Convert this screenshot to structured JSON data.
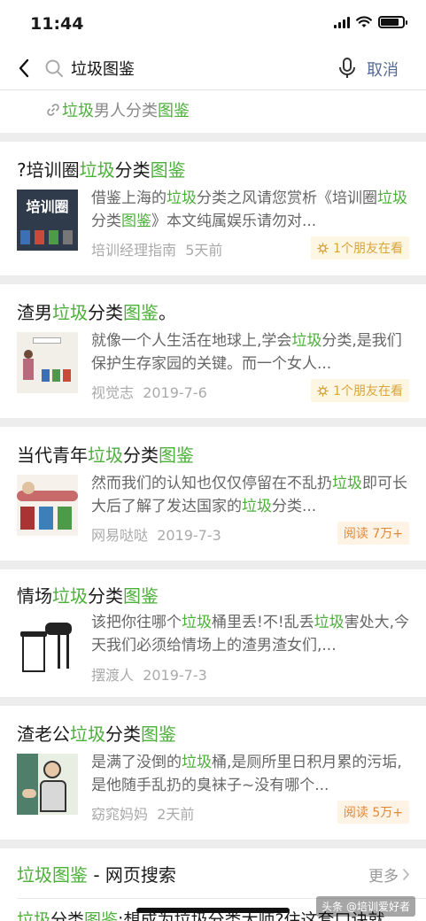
{
  "status_bar": {
    "time": "11:44"
  },
  "search": {
    "query": "垃圾图鉴",
    "cancel_label": "取消"
  },
  "top_link": {
    "hl": "垃圾",
    "rest1": "男人分类",
    "hl2": "图鉴"
  },
  "articles": [
    {
      "title": {
        "a": "?培训圈",
        "b": "垃圾",
        "c": "分类",
        "d": "图鉴",
        "e": ""
      },
      "desc": {
        "a": "借鉴上海的",
        "b": "垃圾",
        "c": "分类之风请您赏析《培训圈",
        "d": "垃圾",
        "e": "分类",
        "f": "图鉴",
        "g": "》本文纯属娱乐请勿对..."
      },
      "source": "培训经理指南",
      "time": "5天前",
      "badge": "1个朋友在看",
      "badge_icon": "friends-star-icon",
      "thumb_text": "培训圈"
    },
    {
      "title": {
        "a": "渣男",
        "b": "垃圾",
        "c": "分类",
        "d": "图鉴",
        "e": "。"
      },
      "desc": {
        "a": "就像一个人生活在地球上,学会",
        "b": "垃圾",
        "c": "分类,是我们保护生存家园的关键。而一个女人...",
        "d": "",
        "e": "",
        "f": "",
        "g": ""
      },
      "source": "视觉志",
      "time": "2019-7-6",
      "badge": "1个朋友在看",
      "badge_icon": "friends-star-icon"
    },
    {
      "title": {
        "a": "当代青年",
        "b": "垃圾",
        "c": "分类",
        "d": "图鉴",
        "e": ""
      },
      "desc": {
        "a": "然而我们的认知也仅仅停留在不乱扔",
        "b": "垃圾",
        "c": "即可长大后了解了发达国家的",
        "d": "垃圾",
        "e": "分类...",
        "f": "",
        "g": ""
      },
      "source": "网易哒哒",
      "time": "2019-7-3",
      "badge": "阅读 7万+"
    },
    {
      "title": {
        "a": "情场",
        "b": "垃圾",
        "c": "分类",
        "d": "图鉴",
        "e": ""
      },
      "desc": {
        "a": "该把你往哪个",
        "b": "垃圾",
        "c": "桶里丢!不!乱丢",
        "d": "垃圾",
        "e": "害处大,今天我们必须给情场上的渣男渣女们,...",
        "f": "",
        "g": ""
      },
      "source": "摆渡人",
      "time": "2019-7-3",
      "badge": ""
    },
    {
      "title": {
        "a": "渣老公",
        "b": "垃圾",
        "c": "分类",
        "d": "图鉴",
        "e": ""
      },
      "desc": {
        "a": "是满了没倒的",
        "b": "垃圾",
        "c": "桶,是厕所里日积月累的污垢,是他随手乱扔的臭袜子~没有哪个...",
        "d": "",
        "e": "",
        "f": "",
        "g": ""
      },
      "source": "窈窕妈妈",
      "time": "2天前",
      "badge": "阅读 5万+"
    }
  ],
  "web_search": {
    "title_hl": "垃圾图鉴",
    "title_rest": " - 网页搜索",
    "more_label": "更多",
    "snippet_hl1": "垃圾",
    "snippet_mid": "分类",
    "snippet_hl2": "图鉴",
    "snippet_rest": ":想成为垃圾分类大师?住这套口诀就"
  },
  "watermark": "头条 @培训爱好者",
  "colors": {
    "highlight": "#4caf3a",
    "link_blue": "#576b95",
    "badge_bg": "#fdf6e3",
    "badge_text": "#d9a43c"
  }
}
